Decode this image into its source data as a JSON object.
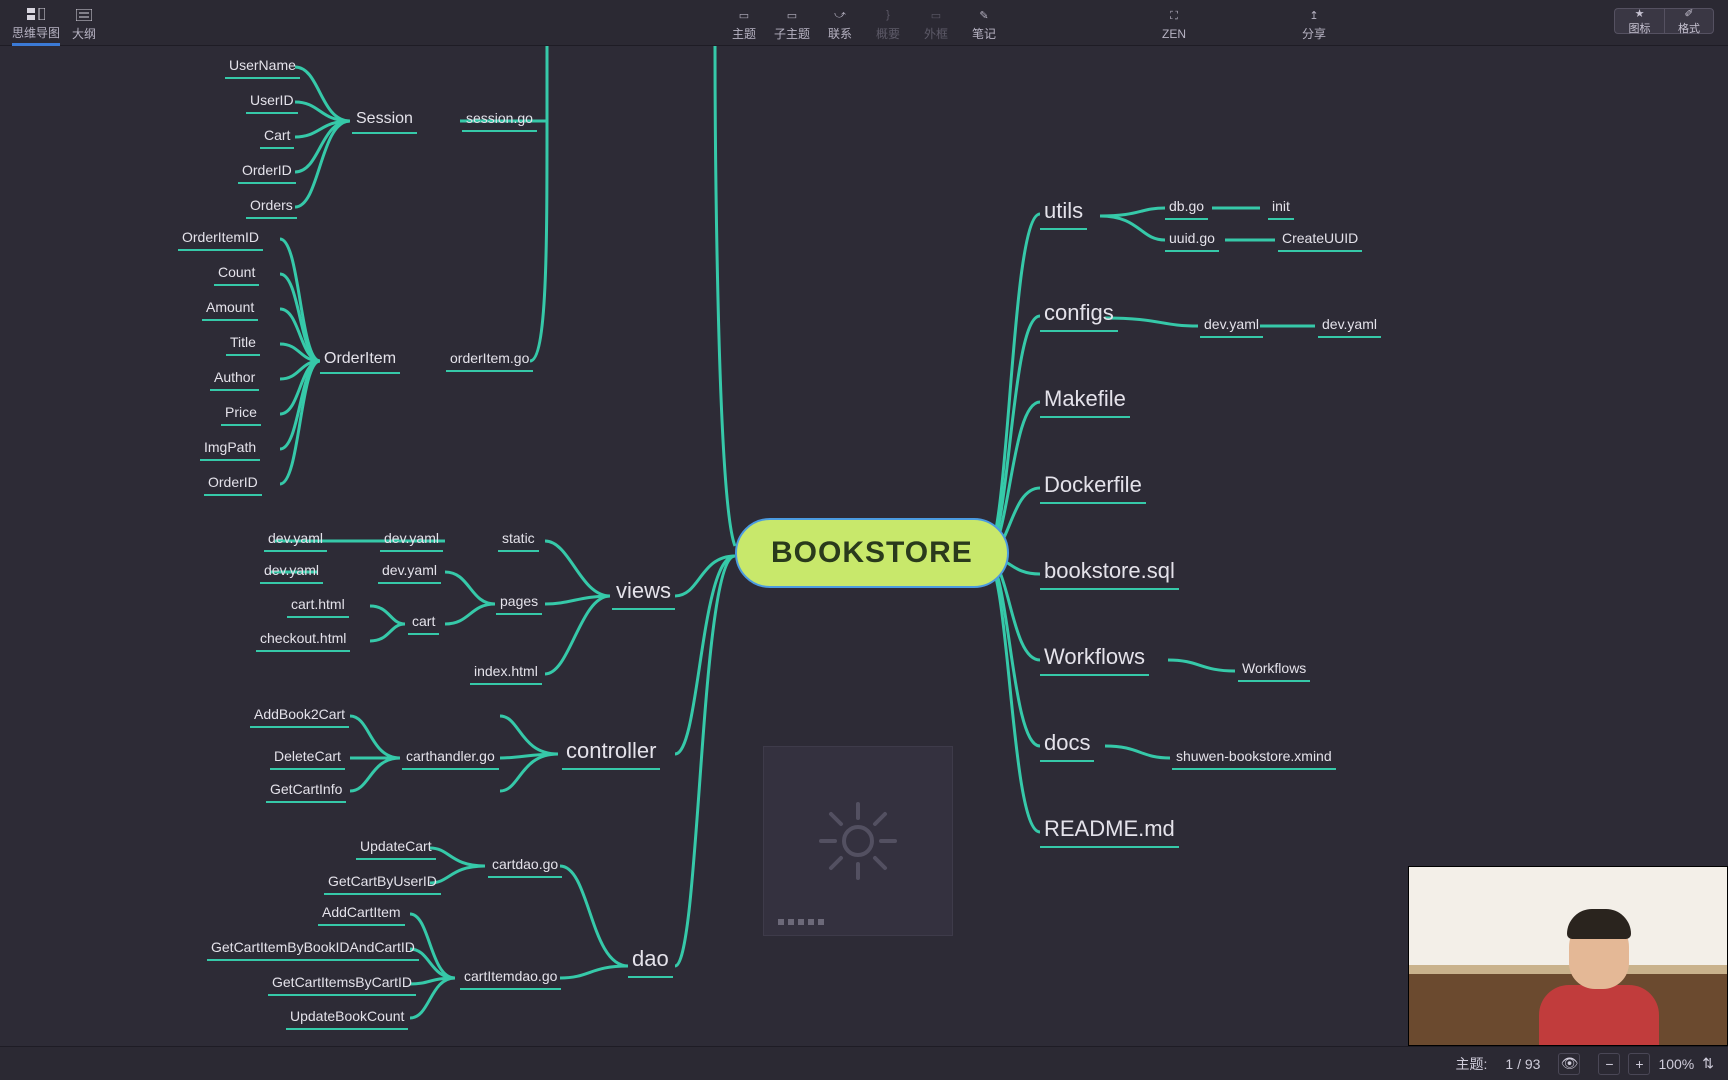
{
  "toolbar": {
    "left": {
      "mindmap": "思维导图",
      "outline": "大纲"
    },
    "center": {
      "topic": "主题",
      "subtopic": "子主题",
      "relation": "联系",
      "summary": "概要",
      "boundary": "外框",
      "note": "笔记"
    },
    "zen": "ZEN",
    "share": "分享",
    "right": {
      "icon": "图标",
      "format": "格式"
    }
  },
  "mindmap": {
    "root": "BOOKSTORE",
    "left": {
      "session": {
        "label": "Session",
        "file": "session.go",
        "children": [
          "UserName",
          "UserID",
          "Cart",
          "OrderID",
          "Orders"
        ]
      },
      "orderItem": {
        "label": "OrderItem",
        "file": "orderItem.go",
        "children": [
          "OrderItemID",
          "Count",
          "Amount",
          "Title",
          "Author",
          "Price",
          "ImgPath",
          "OrderID"
        ]
      },
      "views": {
        "label": "views",
        "static": {
          "label": "static",
          "devA": "dev.yaml",
          "devB": "dev.yaml"
        },
        "pages": {
          "label": "pages",
          "devC": "dev.yaml",
          "devD": "dev.yaml",
          "cart": {
            "label": "cart",
            "children": [
              "cart.html",
              "checkout.html"
            ]
          },
          "index": "index.html"
        }
      },
      "controller": {
        "label": "controller",
        "file": "carthandler.go",
        "children": [
          "AddBook2Cart",
          "DeleteCart",
          "GetCartInfo"
        ]
      },
      "dao": {
        "label": "dao",
        "cartdao": {
          "label": "cartdao.go",
          "children": [
            "UpdateCart",
            "GetCartByUserID"
          ]
        },
        "cartItemdao": {
          "label": "cartItemdao.go",
          "children": [
            "AddCartItem",
            "GetCartItemByBookIDAndCartID",
            "GetCartItemsByCartID",
            "UpdateBookCount"
          ]
        }
      }
    },
    "right": {
      "utils": {
        "label": "utils",
        "db": {
          "file": "db.go",
          "fn": "init"
        },
        "uuid": {
          "file": "uuid.go",
          "fn": "CreateUUID"
        }
      },
      "configs": {
        "label": "configs",
        "file": "dev.yaml",
        "val": "dev.yaml"
      },
      "makefile": "Makefile",
      "dockerfile": "Dockerfile",
      "sql": "bookstore.sql",
      "workflows": {
        "label": "Workflows",
        "child": "Workflows"
      },
      "docs": {
        "label": "docs",
        "child": "shuwen-bookstore.xmind"
      },
      "readme": "README.md"
    }
  },
  "status": {
    "topic_label": "主题:",
    "topic_count": "1 / 93",
    "zoom": "100%"
  }
}
